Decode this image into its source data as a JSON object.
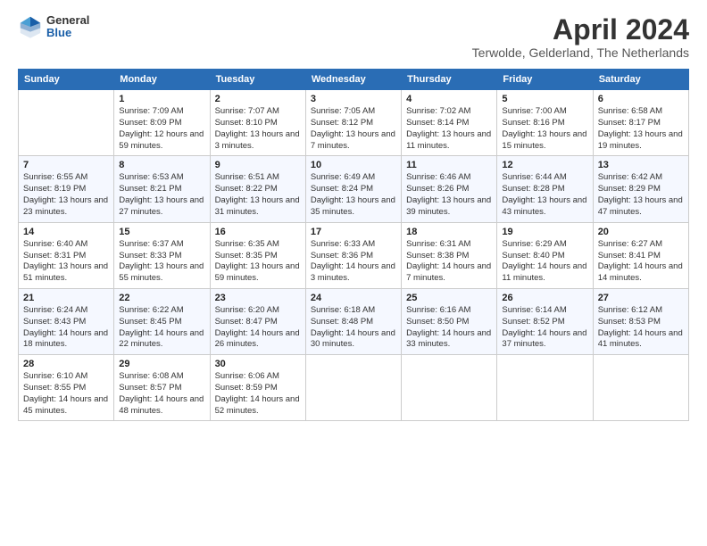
{
  "header": {
    "logo_line1": "General",
    "logo_line2": "Blue",
    "title": "April 2024",
    "subtitle": "Terwolde, Gelderland, The Netherlands"
  },
  "days_of_week": [
    "Sunday",
    "Monday",
    "Tuesday",
    "Wednesday",
    "Thursday",
    "Friday",
    "Saturday"
  ],
  "weeks": [
    [
      {
        "day": "",
        "sunrise": "",
        "sunset": "",
        "daylight": ""
      },
      {
        "day": "1",
        "sunrise": "Sunrise: 7:09 AM",
        "sunset": "Sunset: 8:09 PM",
        "daylight": "Daylight: 12 hours and 59 minutes."
      },
      {
        "day": "2",
        "sunrise": "Sunrise: 7:07 AM",
        "sunset": "Sunset: 8:10 PM",
        "daylight": "Daylight: 13 hours and 3 minutes."
      },
      {
        "day": "3",
        "sunrise": "Sunrise: 7:05 AM",
        "sunset": "Sunset: 8:12 PM",
        "daylight": "Daylight: 13 hours and 7 minutes."
      },
      {
        "day": "4",
        "sunrise": "Sunrise: 7:02 AM",
        "sunset": "Sunset: 8:14 PM",
        "daylight": "Daylight: 13 hours and 11 minutes."
      },
      {
        "day": "5",
        "sunrise": "Sunrise: 7:00 AM",
        "sunset": "Sunset: 8:16 PM",
        "daylight": "Daylight: 13 hours and 15 minutes."
      },
      {
        "day": "6",
        "sunrise": "Sunrise: 6:58 AM",
        "sunset": "Sunset: 8:17 PM",
        "daylight": "Daylight: 13 hours and 19 minutes."
      }
    ],
    [
      {
        "day": "7",
        "sunrise": "Sunrise: 6:55 AM",
        "sunset": "Sunset: 8:19 PM",
        "daylight": "Daylight: 13 hours and 23 minutes."
      },
      {
        "day": "8",
        "sunrise": "Sunrise: 6:53 AM",
        "sunset": "Sunset: 8:21 PM",
        "daylight": "Daylight: 13 hours and 27 minutes."
      },
      {
        "day": "9",
        "sunrise": "Sunrise: 6:51 AM",
        "sunset": "Sunset: 8:22 PM",
        "daylight": "Daylight: 13 hours and 31 minutes."
      },
      {
        "day": "10",
        "sunrise": "Sunrise: 6:49 AM",
        "sunset": "Sunset: 8:24 PM",
        "daylight": "Daylight: 13 hours and 35 minutes."
      },
      {
        "day": "11",
        "sunrise": "Sunrise: 6:46 AM",
        "sunset": "Sunset: 8:26 PM",
        "daylight": "Daylight: 13 hours and 39 minutes."
      },
      {
        "day": "12",
        "sunrise": "Sunrise: 6:44 AM",
        "sunset": "Sunset: 8:28 PM",
        "daylight": "Daylight: 13 hours and 43 minutes."
      },
      {
        "day": "13",
        "sunrise": "Sunrise: 6:42 AM",
        "sunset": "Sunset: 8:29 PM",
        "daylight": "Daylight: 13 hours and 47 minutes."
      }
    ],
    [
      {
        "day": "14",
        "sunrise": "Sunrise: 6:40 AM",
        "sunset": "Sunset: 8:31 PM",
        "daylight": "Daylight: 13 hours and 51 minutes."
      },
      {
        "day": "15",
        "sunrise": "Sunrise: 6:37 AM",
        "sunset": "Sunset: 8:33 PM",
        "daylight": "Daylight: 13 hours and 55 minutes."
      },
      {
        "day": "16",
        "sunrise": "Sunrise: 6:35 AM",
        "sunset": "Sunset: 8:35 PM",
        "daylight": "Daylight: 13 hours and 59 minutes."
      },
      {
        "day": "17",
        "sunrise": "Sunrise: 6:33 AM",
        "sunset": "Sunset: 8:36 PM",
        "daylight": "Daylight: 14 hours and 3 minutes."
      },
      {
        "day": "18",
        "sunrise": "Sunrise: 6:31 AM",
        "sunset": "Sunset: 8:38 PM",
        "daylight": "Daylight: 14 hours and 7 minutes."
      },
      {
        "day": "19",
        "sunrise": "Sunrise: 6:29 AM",
        "sunset": "Sunset: 8:40 PM",
        "daylight": "Daylight: 14 hours and 11 minutes."
      },
      {
        "day": "20",
        "sunrise": "Sunrise: 6:27 AM",
        "sunset": "Sunset: 8:41 PM",
        "daylight": "Daylight: 14 hours and 14 minutes."
      }
    ],
    [
      {
        "day": "21",
        "sunrise": "Sunrise: 6:24 AM",
        "sunset": "Sunset: 8:43 PM",
        "daylight": "Daylight: 14 hours and 18 minutes."
      },
      {
        "day": "22",
        "sunrise": "Sunrise: 6:22 AM",
        "sunset": "Sunset: 8:45 PM",
        "daylight": "Daylight: 14 hours and 22 minutes."
      },
      {
        "day": "23",
        "sunrise": "Sunrise: 6:20 AM",
        "sunset": "Sunset: 8:47 PM",
        "daylight": "Daylight: 14 hours and 26 minutes."
      },
      {
        "day": "24",
        "sunrise": "Sunrise: 6:18 AM",
        "sunset": "Sunset: 8:48 PM",
        "daylight": "Daylight: 14 hours and 30 minutes."
      },
      {
        "day": "25",
        "sunrise": "Sunrise: 6:16 AM",
        "sunset": "Sunset: 8:50 PM",
        "daylight": "Daylight: 14 hours and 33 minutes."
      },
      {
        "day": "26",
        "sunrise": "Sunrise: 6:14 AM",
        "sunset": "Sunset: 8:52 PM",
        "daylight": "Daylight: 14 hours and 37 minutes."
      },
      {
        "day": "27",
        "sunrise": "Sunrise: 6:12 AM",
        "sunset": "Sunset: 8:53 PM",
        "daylight": "Daylight: 14 hours and 41 minutes."
      }
    ],
    [
      {
        "day": "28",
        "sunrise": "Sunrise: 6:10 AM",
        "sunset": "Sunset: 8:55 PM",
        "daylight": "Daylight: 14 hours and 45 minutes."
      },
      {
        "day": "29",
        "sunrise": "Sunrise: 6:08 AM",
        "sunset": "Sunset: 8:57 PM",
        "daylight": "Daylight: 14 hours and 48 minutes."
      },
      {
        "day": "30",
        "sunrise": "Sunrise: 6:06 AM",
        "sunset": "Sunset: 8:59 PM",
        "daylight": "Daylight: 14 hours and 52 minutes."
      },
      {
        "day": "",
        "sunrise": "",
        "sunset": "",
        "daylight": ""
      },
      {
        "day": "",
        "sunrise": "",
        "sunset": "",
        "daylight": ""
      },
      {
        "day": "",
        "sunrise": "",
        "sunset": "",
        "daylight": ""
      },
      {
        "day": "",
        "sunrise": "",
        "sunset": "",
        "daylight": ""
      }
    ]
  ]
}
